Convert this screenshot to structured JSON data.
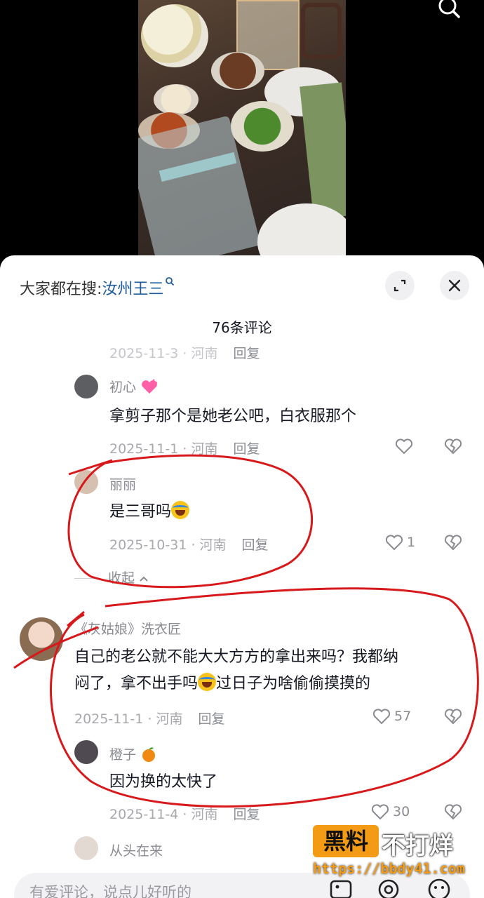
{
  "header": {
    "hot_search_prefix": "大家都在搜:",
    "hot_search_keyword": "汝州王三",
    "comment_count": "76条评论"
  },
  "comments": {
    "partial_top": {
      "meta": "2025-11-3 · 河南",
      "reply": "回复"
    },
    "c1": {
      "name": "初心",
      "text": "拿剪子那个是她老公吧，白衣服那个",
      "meta": "2025-11-1 · 河南",
      "reply": "回复"
    },
    "c2": {
      "name": "丽丽",
      "text": "是三哥吗",
      "meta": "2025-10-31 · 河南",
      "reply": "回复",
      "likes": "1"
    },
    "collapse_label": "收起",
    "c3": {
      "name": "《灰姑娘》洗衣匠",
      "text_line1": "自己的老公就不能大大方方的拿出来吗？我都纳",
      "text_line2a": "闷了，拿不出手吗",
      "text_line2b": "过日子为啥偷偷摸摸的",
      "meta": "2025-11-1 · 河南",
      "reply": "回复",
      "likes": "57"
    },
    "c4": {
      "name": "橙子",
      "text": "因为换的太快了",
      "meta": "2025-11-4 · 河南",
      "reply": "回复",
      "likes": "30"
    },
    "c5": {
      "name": "从头在来"
    }
  },
  "input": {
    "placeholder": "有爱评论，说点儿好听的"
  },
  "watermark": {
    "box": "黑料",
    "text": "不打烊",
    "url": "https://bbdy41.com"
  },
  "colors": {
    "annotation_red": "#d8191b",
    "keyword_blue": "#1e5b9c",
    "watermark_orange": "#f49b16"
  }
}
